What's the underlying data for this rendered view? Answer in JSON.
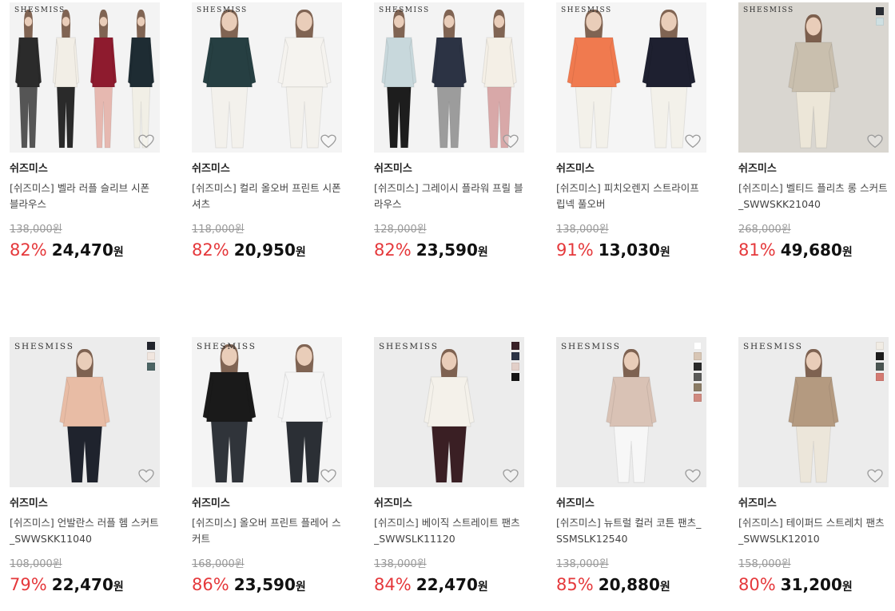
{
  "brand_mark": "SHESMISS",
  "currency": "원",
  "products": [
    {
      "brand": "쉬즈미스",
      "name": "[쉬즈미스] 벨라 러플 슬리브 시폰 블라우스",
      "original_price": "138,000원",
      "discount": "82%",
      "price": "24,470",
      "background": "#f3f3f3",
      "models": [
        {
          "top": "#2b2b2b",
          "bottom": "#555"
        },
        {
          "top": "#f2eee6",
          "bottom": "#2a2a2a"
        },
        {
          "top": "#8e1b2e",
          "bottom": "#e6b8b0"
        },
        {
          "top": "#1e2c33",
          "bottom": "#f1efe6"
        }
      ],
      "swatches": []
    },
    {
      "brand": "쉬즈미스",
      "name": "[쉬즈미스] 컬리 올오버 프린트 시폰 셔츠",
      "original_price": "118,000원",
      "discount": "82%",
      "price": "20,950",
      "background": "#f4f4f4",
      "models": [
        {
          "top": "#263f42",
          "bottom": "#f3f1ec"
        },
        {
          "top": "#f5f3ef",
          "bottom": "#f3f1ec"
        }
      ],
      "swatches": []
    },
    {
      "brand": "쉬즈미스",
      "name": "[쉬즈미스] 그레이시 플라워 프릴 블라우스",
      "original_price": "128,000원",
      "discount": "82%",
      "price": "23,590",
      "background": "#f3f3f3",
      "models": [
        {
          "top": "#c8d8dc",
          "bottom": "#1d1d1d"
        },
        {
          "top": "#2c3344",
          "bottom": "#9c9c9c"
        },
        {
          "top": "#f4efe6",
          "bottom": "#d8a8a8"
        }
      ],
      "swatches": []
    },
    {
      "brand": "쉬즈미스",
      "name": "[쉬즈미스] 피치오렌지 스트라이프 립넥 풀오버",
      "original_price": "138,000원",
      "discount": "91%",
      "price": "13,030",
      "background": "#f5f5f5",
      "models": [
        {
          "top": "#f07a4f",
          "bottom": "#f3f1ea"
        },
        {
          "top": "#1e2030",
          "bottom": "#f3f1ea"
        }
      ],
      "swatches": []
    },
    {
      "brand": "쉬즈미스",
      "name": "[쉬즈미스] 벨티드 플리츠 롱 스커트_SWWSKK21040",
      "original_price": "268,000원",
      "discount": "81%",
      "price": "49,680",
      "background": "#d9d6d0",
      "models": [
        {
          "top": "#c9bfae",
          "bottom": "#ece6d8"
        }
      ],
      "swatches": [
        "#2a2e35",
        "#cfe0e2"
      ]
    },
    {
      "brand": "쉬즈미스",
      "name": "[쉬즈미스] 언발란스 러플 헴 스커트_SWWSKK11040",
      "original_price": "108,000원",
      "discount": "79%",
      "price": "22,470",
      "background": "#ececec",
      "models": [
        {
          "top": "#e8bca5",
          "bottom": "#1f232d"
        }
      ],
      "swatches": [
        "#22252d",
        "#f1e6df",
        "#4c6565"
      ]
    },
    {
      "brand": "쉬즈미스",
      "name": "[쉬즈미스] 올오버 프린트 플레어 스커트",
      "original_price": "168,000원",
      "discount": "86%",
      "price": "23,590",
      "background": "#f4f4f4",
      "models": [
        {
          "top": "#1a1a1a",
          "bottom": "#30343a"
        },
        {
          "top": "#f5f5f5",
          "bottom": "#2b2f35"
        }
      ],
      "swatches": []
    },
    {
      "brand": "쉬즈미스",
      "name": "[쉬즈미스] 베이직 스트레이트 팬츠_SWWSLK11120",
      "original_price": "138,000원",
      "discount": "84%",
      "price": "22,470",
      "background": "#ececec",
      "models": [
        {
          "top": "#f4f1ea",
          "bottom": "#3a1f24"
        }
      ],
      "swatches": [
        "#3a2228",
        "#2c3446",
        "#e2cfc8",
        "#151515"
      ]
    },
    {
      "brand": "쉬즈미스",
      "name": "[쉬즈미스] 뉴트럴 컬러 코튼 팬츠_SSMSLK12540",
      "original_price": "138,000원",
      "discount": "85%",
      "price": "20,880",
      "background": "#ececec",
      "models": [
        {
          "top": "#d9c2b5",
          "bottom": "#f7f7f7"
        }
      ],
      "swatches": [
        "#ffffff",
        "#d8c6b5",
        "#2a2a2a",
        "#5a5a58",
        "#8b7c66",
        "#d08a80"
      ]
    },
    {
      "brand": "쉬즈미스",
      "name": "[쉬즈미스] 테이퍼드 스트레치 팬츠_SWWSLK12010",
      "original_price": "158,000원",
      "discount": "80%",
      "price": "31,200",
      "background": "#ececec",
      "models": [
        {
          "top": "#b49a80",
          "bottom": "#ece6da"
        }
      ],
      "swatches": [
        "#f1ece4",
        "#1c1c1c",
        "#4a5552",
        "#d47a72"
      ]
    }
  ]
}
